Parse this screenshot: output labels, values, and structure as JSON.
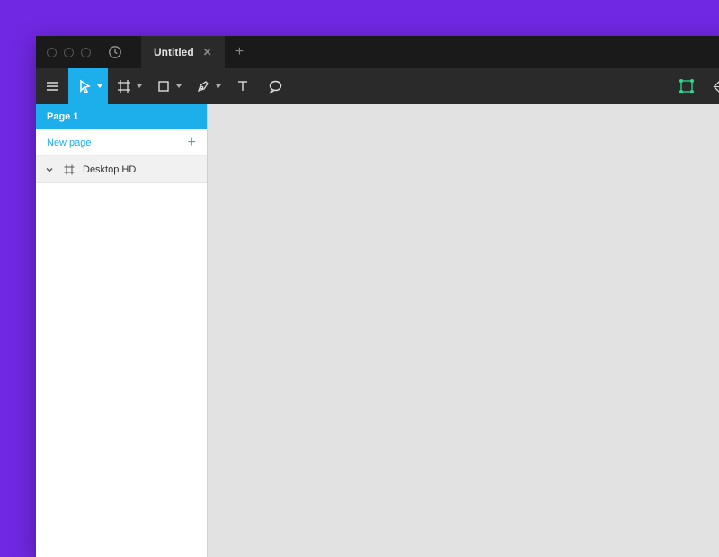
{
  "window": {
    "tab_title": "Untitled"
  },
  "sidebar": {
    "page_label": "Page 1",
    "new_page_label": "New page",
    "layers": [
      {
        "name": "Desktop HD"
      }
    ]
  }
}
